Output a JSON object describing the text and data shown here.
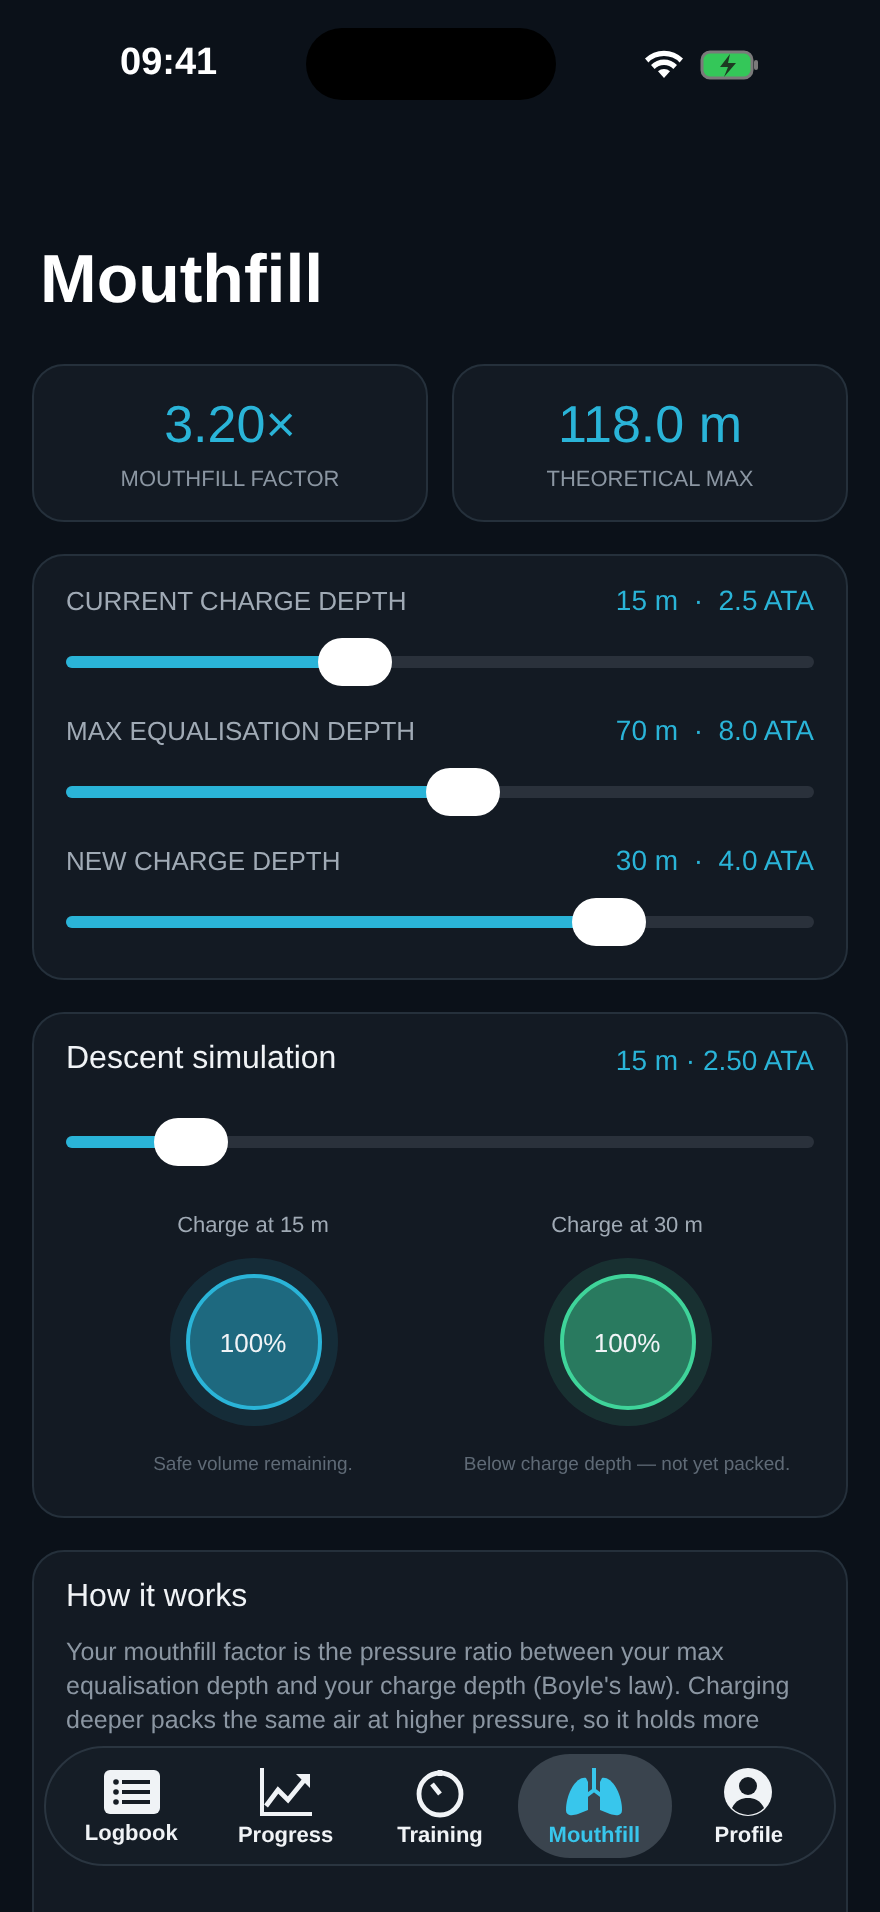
{
  "status_bar": {
    "time": "09:41"
  },
  "title": "Mouthfill",
  "stats": [
    {
      "value": "3.20×",
      "label": "MOUTHFILL FACTOR"
    },
    {
      "value": "118.0 m",
      "label": "THEORETICAL MAX"
    }
  ],
  "depth_sliders": [
    {
      "label": "CURRENT CHARGE DEPTH",
      "reading": "15 m  ·  2.5 ATA",
      "level": 0.386
    },
    {
      "label": "MAX EQUALISATION DEPTH",
      "reading": "70 m  ·  8.0 ATA",
      "level": 0.53
    },
    {
      "label": "NEW CHARGE DEPTH",
      "reading": "30 m  ·  4.0 ATA",
      "level": 0.725
    }
  ],
  "simulation": {
    "title": "Descent simulation",
    "reading": "15 m · 2.50 ATA",
    "level": 0.165,
    "charges": [
      {
        "label": "Charge at 15 m",
        "value": "100%",
        "note": "Safe volume remaining.",
        "color": "#2ab4d8"
      },
      {
        "label": "Charge at 30 m",
        "value": "100%",
        "note": "Below charge depth — not yet packed.",
        "color": "#3fd49a"
      }
    ]
  },
  "how_it_works": {
    "title": "How it works",
    "text": "Your mouthfill factor is the pressure ratio between your max equalisation depth and your charge depth (Boyle's law). Charging deeper packs the same air at higher pressure, so it holds more"
  },
  "tabs": [
    {
      "label": "Logbook",
      "selected": false
    },
    {
      "label": "Progress",
      "selected": false
    },
    {
      "label": "Training",
      "selected": false
    },
    {
      "label": "Mouthfill",
      "selected": true
    },
    {
      "label": "Profile",
      "selected": false
    }
  ]
}
